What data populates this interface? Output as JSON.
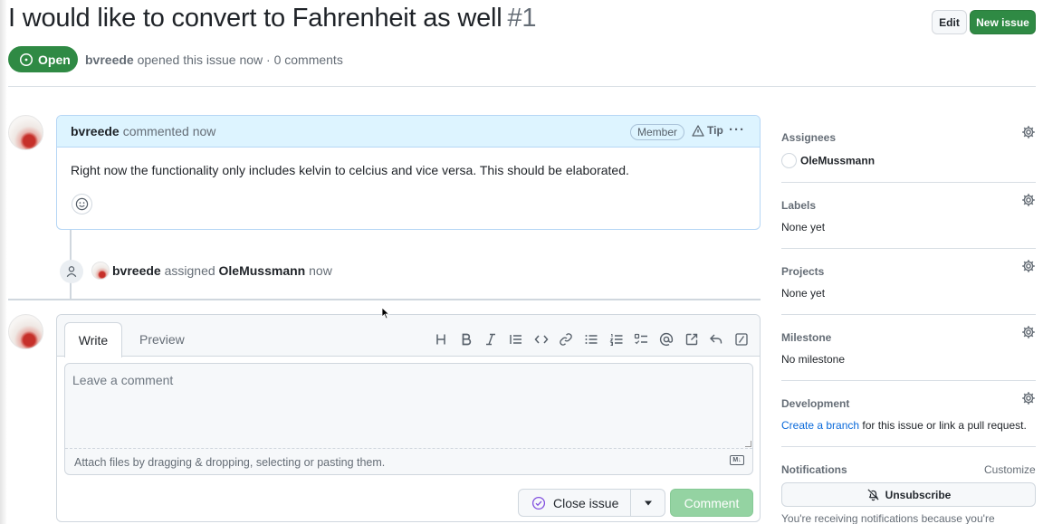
{
  "header": {
    "title": "I would like to convert to Fahrenheit as well",
    "number": "#1",
    "edit_label": "Edit",
    "new_issue_label": "New issue",
    "state": "Open",
    "author": "bvreede",
    "meta_suffix": "opened this issue now · 0 comments"
  },
  "comment": {
    "author": "bvreede",
    "time": "commented now",
    "badge": "Member",
    "tip": "Tip",
    "body": "Right now the functionality only includes kelvin to celcius and vice versa. This should be elaborated."
  },
  "event": {
    "actor": "bvreede",
    "action": "assigned",
    "target": "OleMussmann",
    "time": "now"
  },
  "composer": {
    "tab_write": "Write",
    "tab_preview": "Preview",
    "toolbar": [
      "heading-icon",
      "bold-icon",
      "italic-icon",
      "quote-icon",
      "code-icon",
      "link-icon",
      "unordered-list-icon",
      "ordered-list-icon",
      "task-list-icon",
      "mention-icon",
      "cross-reference-icon",
      "saved-reply-icon",
      "slash-command-icon"
    ],
    "placeholder": "Leave a comment",
    "attach_hint": "Attach files by dragging & dropping, selecting or pasting them.",
    "close_issue_label": "Close issue",
    "comment_label": "Comment"
  },
  "sidebar": {
    "assignees": {
      "label": "Assignees",
      "value": "OleMussmann"
    },
    "labels": {
      "label": "Labels",
      "value": "None yet"
    },
    "projects": {
      "label": "Projects",
      "value": "None yet"
    },
    "milestone": {
      "label": "Milestone",
      "value": "No milestone"
    },
    "development": {
      "label": "Development",
      "link": "Create a branch",
      "suffix": " for this issue or link a pull request."
    },
    "notifications": {
      "label": "Notifications",
      "customize": "Customize",
      "unsubscribe": "Unsubscribe",
      "reason": "You're receiving notifications because you're"
    }
  },
  "colors": {
    "open_green": "#2f8a44",
    "comment_header_blue": "#ddf4ff",
    "link_blue": "#0969da",
    "disabled_comment_green": "#94d3a2"
  }
}
